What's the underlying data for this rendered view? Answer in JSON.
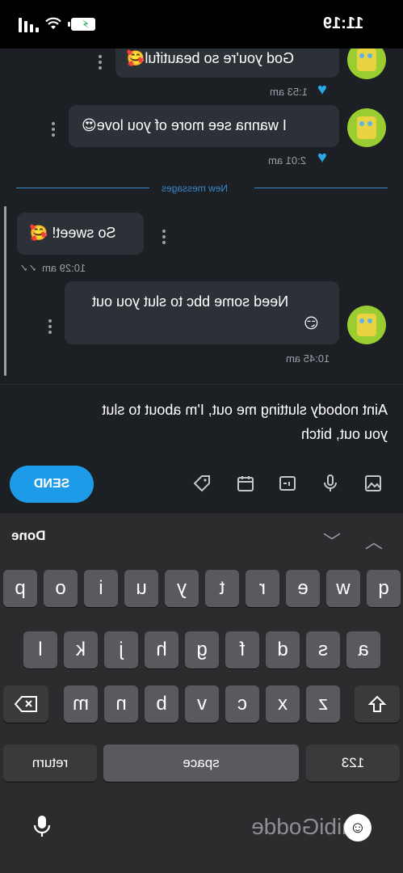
{
  "status": {
    "time": "11:19"
  },
  "messages": [
    {
      "text": "God you're so beautiful🥰",
      "time": "1:53 am"
    },
    {
      "text": "I wanna see more of you love😍",
      "time": "2:01 am"
    },
    {
      "text": "So sweet! 🥰",
      "time": "10:29 am"
    },
    {
      "text_line1": "Need some bbc to slut you out",
      "text_line2": "😏",
      "time": "10:45 am"
    }
  ],
  "divider": {
    "label": "New messages"
  },
  "compose": {
    "text_line1": "Aint nobody slutting me out, I'm about to slut",
    "text_line2": "you out, bitch",
    "send_label": "SEND"
  },
  "keyboard": {
    "done_label": "Done",
    "row1": [
      "q",
      "w",
      "e",
      "r",
      "t",
      "y",
      "u",
      "i",
      "o",
      "p"
    ],
    "row2": [
      "a",
      "s",
      "d",
      "f",
      "g",
      "h",
      "j",
      "k",
      "l"
    ],
    "row3": [
      "z",
      "x",
      "c",
      "v",
      "b",
      "n",
      "m"
    ],
    "numbers_label": "123",
    "space_label": "space",
    "return_label": "return",
    "suggestion_text": "ChibiGodde"
  },
  "colors": {
    "accent": "#1e9be8",
    "heart": "#29a8e6",
    "divider": "#3a89c9"
  },
  "icons": [
    "battery-icon",
    "wifi-icon",
    "signal-icon",
    "heart-icon",
    "more-icon",
    "image-icon",
    "mic-icon",
    "gif-icon",
    "calendar-icon",
    "tag-icon",
    "backspace-icon",
    "shift-icon",
    "emoji-icon",
    "chevron-up-icon",
    "chevron-down-icon"
  ]
}
